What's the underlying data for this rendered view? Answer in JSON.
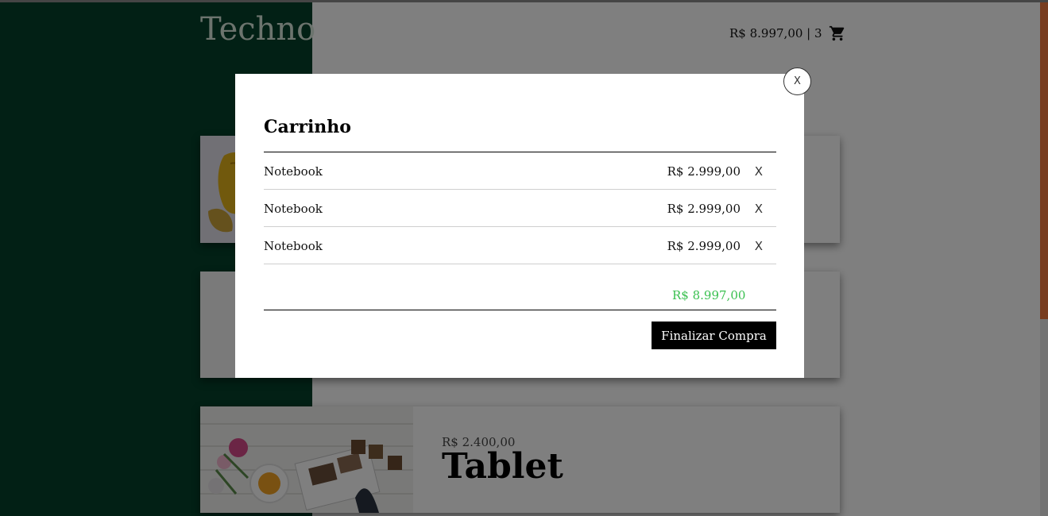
{
  "header": {
    "logo": "Techno",
    "cart_summary": "R$ 8.997,00 | 3",
    "cart_icon": "shopping-cart-icon"
  },
  "products": [
    {
      "name": "",
      "price": ""
    },
    {
      "name": "",
      "price": ""
    },
    {
      "name": "Tablet",
      "price": "R$ 2.400,00"
    }
  ],
  "modal": {
    "close_label": "X",
    "title": "Carrinho",
    "items": [
      {
        "name": "Notebook",
        "price": "R$ 2.999,00",
        "remove_label": "X"
      },
      {
        "name": "Notebook",
        "price": "R$ 2.999,00",
        "remove_label": "X"
      },
      {
        "name": "Notebook",
        "price": "R$ 2.999,00",
        "remove_label": "X"
      }
    ],
    "total": "R$ 8.997,00",
    "checkout_label": "Finalizar Compra"
  },
  "colors": {
    "brand_green": "#04402a",
    "accent_orange": "#f07a41",
    "total_green": "#3ac050"
  }
}
